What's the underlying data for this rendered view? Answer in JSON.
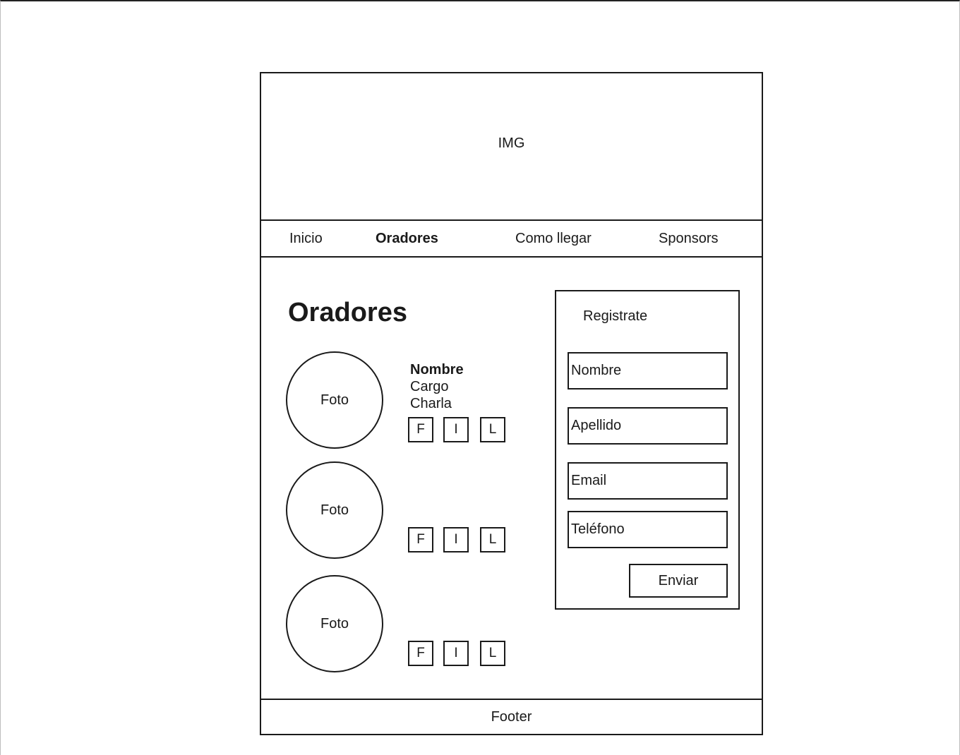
{
  "hero": {
    "label": "IMG"
  },
  "nav": {
    "items": [
      {
        "label": "Inicio",
        "active": false
      },
      {
        "label": "Oradores",
        "active": true
      },
      {
        "label": "Como llegar",
        "active": false
      },
      {
        "label": "Sponsors",
        "active": false
      }
    ]
  },
  "section": {
    "title": "Oradores"
  },
  "speakers": [
    {
      "photo": "Foto",
      "name": "Nombre",
      "role": "Cargo",
      "talk": "Charla",
      "socials": [
        "F",
        "I",
        "L"
      ]
    },
    {
      "photo": "Foto",
      "socials": [
        "F",
        "I",
        "L"
      ]
    },
    {
      "photo": "Foto",
      "socials": [
        "F",
        "I",
        "L"
      ]
    }
  ],
  "form": {
    "title": "Registrate",
    "fields": [
      {
        "placeholder": "Nombre"
      },
      {
        "placeholder": "Apellido"
      },
      {
        "placeholder": "Email"
      },
      {
        "placeholder": "Teléfono"
      }
    ],
    "submit_label": "Enviar"
  },
  "footer": {
    "label": "Footer"
  }
}
